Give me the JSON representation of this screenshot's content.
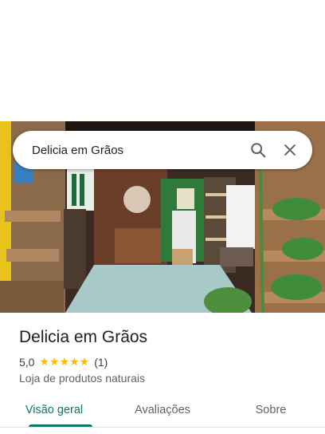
{
  "search": {
    "query": "Delicia em Grãos",
    "search_icon": "search-icon",
    "close_icon": "close-icon"
  },
  "place": {
    "name": "Delicia em Grãos",
    "rating": "5,0",
    "stars": "★★★★★",
    "review_count": "(1)",
    "category": "Loja de produtos naturais"
  },
  "tabs": [
    {
      "label": "Visão geral",
      "active": true
    },
    {
      "label": "Avaliações",
      "active": false
    },
    {
      "label": "Sobre",
      "active": false
    }
  ],
  "colors": {
    "accent": "#0b7a6b",
    "star": "#fbbc04"
  }
}
